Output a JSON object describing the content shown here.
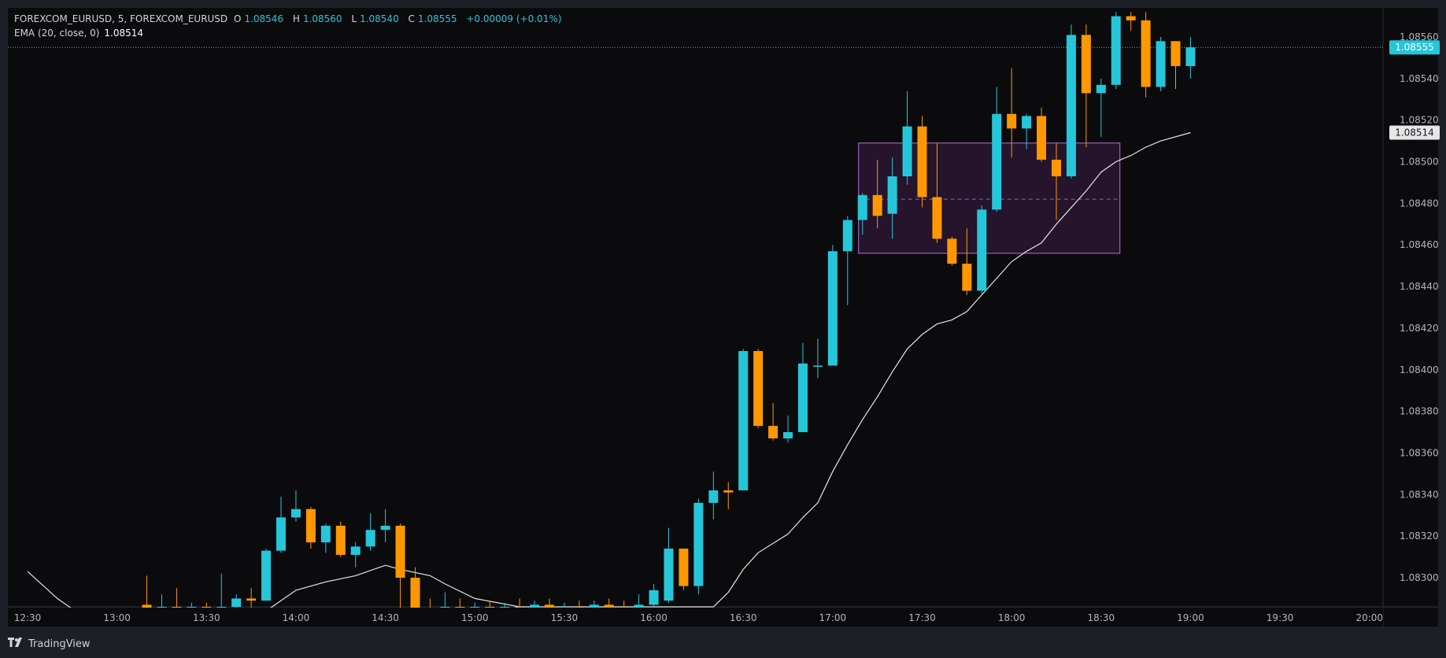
{
  "legend": {
    "symbol": "FOREXCOM_EURUSD, 5, FOREXCOM_EURUSD",
    "o_label": "O",
    "o": "1.08546",
    "h_label": "H",
    "h": "1.08560",
    "l_label": "L",
    "l": "1.08540",
    "c_label": "C",
    "c": "1.08555",
    "change": "+0.00009 (+0.01%)",
    "ema_label": "EMA (20, close, 0)",
    "ema_value": "1.08514"
  },
  "brand": {
    "name": "TradingView",
    "logo_icon": "tradingview-logo-icon"
  },
  "colors": {
    "background": "#0b0b0d",
    "up": "#26c6da",
    "down": "#ff9800",
    "ema": "#e6e6e6",
    "box_fill": "#2a1631",
    "box_border": "#b46fd9",
    "price_line": "#26c6da",
    "axis_text": "#b2b5be"
  },
  "chart_data": {
    "type": "candlestick",
    "series_name": "FOREXCOM_EURUSD, 5",
    "x_ticks": [
      "12:30",
      "13:00",
      "13:30",
      "14:00",
      "14:30",
      "15:00",
      "15:30",
      "16:00",
      "16:30",
      "17:00",
      "17:30",
      "18:00",
      "18:30",
      "19:00",
      "19:30",
      "20:00"
    ],
    "y_ticks": [
      "1.08300",
      "1.08320",
      "1.08340",
      "1.08360",
      "1.08380",
      "1.08400",
      "1.08420",
      "1.08440",
      "1.08460",
      "1.08480",
      "1.08500",
      "1.08520",
      "1.08540",
      "1.08560"
    ],
    "ylim": [
      1.08286,
      1.08574
    ],
    "last_price_label": "1.08555",
    "ema_price_label": "1.08514",
    "candles": [
      {
        "t": "13:10",
        "o": 1.08287,
        "h": 1.08301,
        "l": 1.0828,
        "c": 1.08284
      },
      {
        "t": "13:15",
        "o": 1.08284,
        "h": 1.08292,
        "l": 1.0828,
        "c": 1.08286
      },
      {
        "t": "13:20",
        "o": 1.08286,
        "h": 1.08295,
        "l": 1.08278,
        "c": 1.08282
      },
      {
        "t": "13:25",
        "o": 1.08282,
        "h": 1.08288,
        "l": 1.08279,
        "c": 1.08286
      },
      {
        "t": "13:30",
        "o": 1.08286,
        "h": 1.08288,
        "l": 1.08281,
        "c": 1.08285
      },
      {
        "t": "13:35",
        "o": 1.08285,
        "h": 1.08302,
        "l": 1.0828,
        "c": 1.08286
      },
      {
        "t": "13:40",
        "o": 1.08286,
        "h": 1.08292,
        "l": 1.08282,
        "c": 1.0829
      },
      {
        "t": "13:45",
        "o": 1.0829,
        "h": 1.08295,
        "l": 1.08284,
        "c": 1.08289
      },
      {
        "t": "13:50",
        "o": 1.08289,
        "h": 1.08314,
        "l": 1.08289,
        "c": 1.08313
      },
      {
        "t": "13:55",
        "o": 1.08313,
        "h": 1.08339,
        "l": 1.08312,
        "c": 1.08329
      },
      {
        "t": "14:00",
        "o": 1.08329,
        "h": 1.08342,
        "l": 1.08327,
        "c": 1.08333
      },
      {
        "t": "14:05",
        "o": 1.08333,
        "h": 1.08334,
        "l": 1.08314,
        "c": 1.08317
      },
      {
        "t": "14:10",
        "o": 1.08317,
        "h": 1.08326,
        "l": 1.08312,
        "c": 1.08325
      },
      {
        "t": "14:15",
        "o": 1.08325,
        "h": 1.08327,
        "l": 1.0831,
        "c": 1.08311
      },
      {
        "t": "14:20",
        "o": 1.08311,
        "h": 1.08317,
        "l": 1.08305,
        "c": 1.08315
      },
      {
        "t": "14:25",
        "o": 1.08315,
        "h": 1.08331,
        "l": 1.08313,
        "c": 1.08323
      },
      {
        "t": "14:30",
        "o": 1.08323,
        "h": 1.08333,
        "l": 1.08317,
        "c": 1.08325
      },
      {
        "t": "14:35",
        "o": 1.08325,
        "h": 1.08326,
        "l": 1.0828,
        "c": 1.083
      },
      {
        "t": "14:40",
        "o": 1.083,
        "h": 1.08305,
        "l": 1.08278,
        "c": 1.08285
      },
      {
        "t": "14:45",
        "o": 1.08285,
        "h": 1.0829,
        "l": 1.08278,
        "c": 1.08282
      },
      {
        "t": "14:50",
        "o": 1.08282,
        "h": 1.08293,
        "l": 1.08279,
        "c": 1.08286
      },
      {
        "t": "14:55",
        "o": 1.08286,
        "h": 1.0829,
        "l": 1.0828,
        "c": 1.08284
      },
      {
        "t": "15:00",
        "o": 1.08284,
        "h": 1.08288,
        "l": 1.08279,
        "c": 1.08286
      },
      {
        "t": "15:05",
        "o": 1.08286,
        "h": 1.08289,
        "l": 1.08281,
        "c": 1.08284
      },
      {
        "t": "15:10",
        "o": 1.08284,
        "h": 1.08288,
        "l": 1.0828,
        "c": 1.08286
      },
      {
        "t": "15:15",
        "o": 1.08286,
        "h": 1.0829,
        "l": 1.08282,
        "c": 1.08285
      },
      {
        "t": "15:20",
        "o": 1.08285,
        "h": 1.08289,
        "l": 1.08281,
        "c": 1.08287
      },
      {
        "t": "15:25",
        "o": 1.08287,
        "h": 1.0829,
        "l": 1.08282,
        "c": 1.08284
      },
      {
        "t": "15:30",
        "o": 1.08284,
        "h": 1.08288,
        "l": 1.08281,
        "c": 1.08286
      },
      {
        "t": "15:35",
        "o": 1.08286,
        "h": 1.08289,
        "l": 1.08282,
        "c": 1.08285
      },
      {
        "t": "15:40",
        "o": 1.08285,
        "h": 1.08289,
        "l": 1.08281,
        "c": 1.08287
      },
      {
        "t": "15:45",
        "o": 1.08287,
        "h": 1.0829,
        "l": 1.08282,
        "c": 1.08286
      },
      {
        "t": "15:50",
        "o": 1.08286,
        "h": 1.08289,
        "l": 1.08281,
        "c": 1.08285
      },
      {
        "t": "15:55",
        "o": 1.08285,
        "h": 1.08292,
        "l": 1.08281,
        "c": 1.08287
      },
      {
        "t": "16:00",
        "o": 1.08287,
        "h": 1.08297,
        "l": 1.08286,
        "c": 1.08294
      },
      {
        "t": "16:05",
        "o": 1.08289,
        "h": 1.08324,
        "l": 1.08288,
        "c": 1.08314
      },
      {
        "t": "16:10",
        "o": 1.08314,
        "h": 1.08314,
        "l": 1.08294,
        "c": 1.08296
      },
      {
        "t": "16:15",
        "o": 1.08296,
        "h": 1.08338,
        "l": 1.08292,
        "c": 1.08336
      },
      {
        "t": "16:20",
        "o": 1.08336,
        "h": 1.08351,
        "l": 1.08328,
        "c": 1.08342
      },
      {
        "t": "16:25",
        "o": 1.08342,
        "h": 1.08346,
        "l": 1.08333,
        "c": 1.08341
      },
      {
        "t": "16:30",
        "o": 1.08342,
        "h": 1.0841,
        "l": 1.08342,
        "c": 1.08409
      },
      {
        "t": "16:35",
        "o": 1.08409,
        "h": 1.0841,
        "l": 1.08372,
        "c": 1.08373
      },
      {
        "t": "16:40",
        "o": 1.08373,
        "h": 1.08384,
        "l": 1.08366,
        "c": 1.08367
      },
      {
        "t": "16:45",
        "o": 1.08367,
        "h": 1.08378,
        "l": 1.08365,
        "c": 1.0837
      },
      {
        "t": "16:50",
        "o": 1.0837,
        "h": 1.08413,
        "l": 1.0837,
        "c": 1.08403
      },
      {
        "t": "16:55",
        "o": 1.08402,
        "h": 1.08415,
        "l": 1.08396,
        "c": 1.08402
      },
      {
        "t": "17:00",
        "o": 1.08402,
        "h": 1.0846,
        "l": 1.08402,
        "c": 1.08457
      },
      {
        "t": "17:05",
        "o": 1.08457,
        "h": 1.08474,
        "l": 1.08431,
        "c": 1.08472
      },
      {
        "t": "17:10",
        "o": 1.08472,
        "h": 1.08485,
        "l": 1.08465,
        "c": 1.08484
      },
      {
        "t": "17:15",
        "o": 1.08484,
        "h": 1.08501,
        "l": 1.08468,
        "c": 1.08474
      },
      {
        "t": "17:20",
        "o": 1.08475,
        "h": 1.08502,
        "l": 1.08463,
        "c": 1.08493
      },
      {
        "t": "17:25",
        "o": 1.08493,
        "h": 1.08534,
        "l": 1.08489,
        "c": 1.08517
      },
      {
        "t": "17:30",
        "o": 1.08517,
        "h": 1.08522,
        "l": 1.08478,
        "c": 1.08483
      },
      {
        "t": "17:35",
        "o": 1.08483,
        "h": 1.08509,
        "l": 1.08461,
        "c": 1.08463
      },
      {
        "t": "17:40",
        "o": 1.08463,
        "h": 1.08464,
        "l": 1.0845,
        "c": 1.08451
      },
      {
        "t": "17:45",
        "o": 1.08451,
        "h": 1.08468,
        "l": 1.08436,
        "c": 1.08438
      },
      {
        "t": "17:50",
        "o": 1.08438,
        "h": 1.08479,
        "l": 1.08436,
        "c": 1.08477
      },
      {
        "t": "17:55",
        "o": 1.08477,
        "h": 1.08536,
        "l": 1.08476,
        "c": 1.08523
      },
      {
        "t": "18:00",
        "o": 1.08523,
        "h": 1.08545,
        "l": 1.08502,
        "c": 1.08516
      },
      {
        "t": "18:05",
        "o": 1.08516,
        "h": 1.08523,
        "l": 1.08506,
        "c": 1.08522
      },
      {
        "t": "18:10",
        "o": 1.08522,
        "h": 1.08526,
        "l": 1.085,
        "c": 1.08501
      },
      {
        "t": "18:15",
        "o": 1.08501,
        "h": 1.08509,
        "l": 1.08472,
        "c": 1.08493
      },
      {
        "t": "18:20",
        "o": 1.08493,
        "h": 1.08566,
        "l": 1.08492,
        "c": 1.08561
      },
      {
        "t": "18:25",
        "o": 1.08561,
        "h": 1.08566,
        "l": 1.08507,
        "c": 1.08533
      },
      {
        "t": "18:30",
        "o": 1.08533,
        "h": 1.0854,
        "l": 1.08512,
        "c": 1.08537
      },
      {
        "t": "18:35",
        "o": 1.08537,
        "h": 1.08572,
        "l": 1.08535,
        "c": 1.0857
      },
      {
        "t": "18:40",
        "o": 1.0857,
        "h": 1.08572,
        "l": 1.08563,
        "c": 1.08568
      },
      {
        "t": "18:45",
        "o": 1.08568,
        "h": 1.08572,
        "l": 1.08531,
        "c": 1.08536
      },
      {
        "t": "18:50",
        "o": 1.08536,
        "h": 1.0856,
        "l": 1.08534,
        "c": 1.08558
      },
      {
        "t": "18:55",
        "o": 1.08558,
        "h": 1.08558,
        "l": 1.08535,
        "c": 1.08546
      },
      {
        "t": "19:00",
        "o": 1.08546,
        "h": 1.0856,
        "l": 1.0854,
        "c": 1.08555
      }
    ],
    "ema": [
      {
        "t": "12:30",
        "v": 1.08303
      },
      {
        "t": "12:40",
        "v": 1.0829
      },
      {
        "t": "12:50",
        "v": 1.0828
      },
      {
        "t": "13:50",
        "v": 1.08284
      },
      {
        "t": "14:00",
        "v": 1.08294
      },
      {
        "t": "14:10",
        "v": 1.08298
      },
      {
        "t": "14:20",
        "v": 1.08301
      },
      {
        "t": "14:30",
        "v": 1.08306
      },
      {
        "t": "14:35",
        "v": 1.08304
      },
      {
        "t": "14:45",
        "v": 1.08301
      },
      {
        "t": "14:50",
        "v": 1.08297
      },
      {
        "t": "15:00",
        "v": 1.0829
      },
      {
        "t": "15:15",
        "v": 1.08286
      },
      {
        "t": "16:20",
        "v": 1.08286
      },
      {
        "t": "16:25",
        "v": 1.08293
      },
      {
        "t": "16:30",
        "v": 1.08304
      },
      {
        "t": "16:35",
        "v": 1.08312
      },
      {
        "t": "16:45",
        "v": 1.08321
      },
      {
        "t": "16:50",
        "v": 1.08329
      },
      {
        "t": "16:55",
        "v": 1.08336
      },
      {
        "t": "17:00",
        "v": 1.08351
      },
      {
        "t": "17:05",
        "v": 1.08364
      },
      {
        "t": "17:10",
        "v": 1.08376
      },
      {
        "t": "17:15",
        "v": 1.08387
      },
      {
        "t": "17:20",
        "v": 1.08399
      },
      {
        "t": "17:25",
        "v": 1.0841
      },
      {
        "t": "17:30",
        "v": 1.08417
      },
      {
        "t": "17:35",
        "v": 1.08422
      },
      {
        "t": "17:40",
        "v": 1.08424
      },
      {
        "t": "17:45",
        "v": 1.08428
      },
      {
        "t": "17:50",
        "v": 1.08436
      },
      {
        "t": "17:55",
        "v": 1.08444
      },
      {
        "t": "18:00",
        "v": 1.08452
      },
      {
        "t": "18:05",
        "v": 1.08457
      },
      {
        "t": "18:10",
        "v": 1.08461
      },
      {
        "t": "18:15",
        "v": 1.0847
      },
      {
        "t": "18:20",
        "v": 1.08478
      },
      {
        "t": "18:25",
        "v": 1.08486
      },
      {
        "t": "18:30",
        "v": 1.08495
      },
      {
        "t": "18:35",
        "v": 1.085
      },
      {
        "t": "18:40",
        "v": 1.08503
      },
      {
        "t": "18:45",
        "v": 1.08507
      },
      {
        "t": "18:50",
        "v": 1.0851
      },
      {
        "t": "19:00",
        "v": 1.08514
      }
    ],
    "range_box": {
      "t_start": "17:10",
      "t_end": "18:35",
      "top": 1.08509,
      "bottom": 1.08456,
      "mid": 1.08482
    }
  }
}
